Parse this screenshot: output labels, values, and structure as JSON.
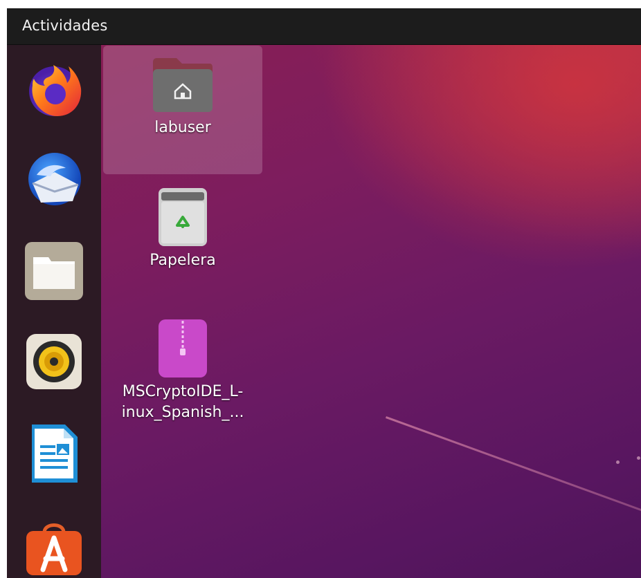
{
  "topbar": {
    "activities_label": "Actividades"
  },
  "dock": {
    "items": [
      {
        "name": "Firefox",
        "icon": "firefox-icon"
      },
      {
        "name": "Thunderbird",
        "icon": "thunderbird-icon"
      },
      {
        "name": "Archivos",
        "icon": "files-icon"
      },
      {
        "name": "Rhythmbox",
        "icon": "rhythmbox-icon"
      },
      {
        "name": "LibreOffice Writer",
        "icon": "libreoffice-writer-icon"
      },
      {
        "name": "Ubuntu Software",
        "icon": "ubuntu-software-icon"
      }
    ]
  },
  "desktop": {
    "items": [
      {
        "label": "labuser",
        "icon": "home-folder-icon",
        "selected": true
      },
      {
        "label": "Papelera",
        "icon": "trash-icon",
        "selected": false
      },
      {
        "label_line1": "MSCryptoIDE_L-",
        "label_line2": "inux_Spanish_...",
        "icon": "zip-archive-icon",
        "selected": false
      }
    ]
  },
  "colors": {
    "topbar": "#1c1c1c",
    "dock": "#2c1a24",
    "wallpaper_primary": "#7d1d5e",
    "wallpaper_accent": "#c8323c"
  }
}
